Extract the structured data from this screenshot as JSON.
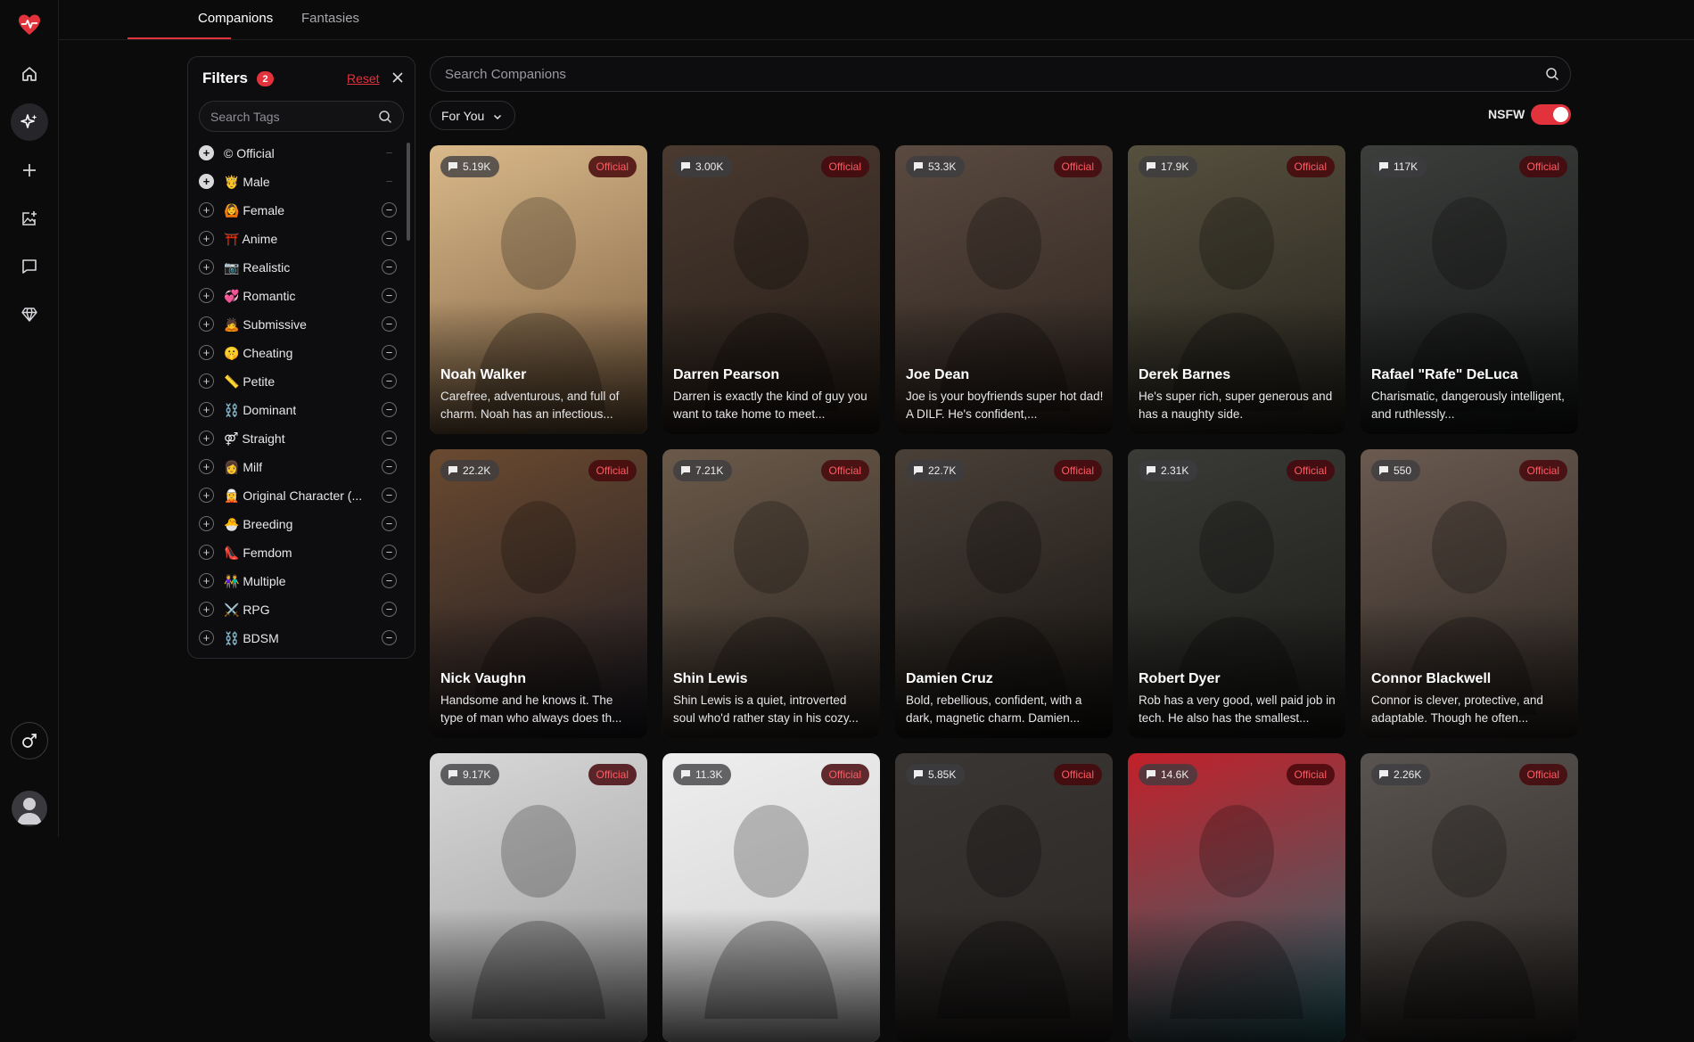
{
  "topbar": {
    "tabs": [
      {
        "label": "Companions",
        "active": true
      },
      {
        "label": "Fantasies",
        "active": false
      }
    ]
  },
  "rail": {
    "items": [
      "home-icon",
      "sparkles-icon",
      "plus-icon",
      "image-plus-icon",
      "chat-icon",
      "diamond-icon"
    ],
    "gender": "male-icon",
    "accent": "#e2323c"
  },
  "filters": {
    "title": "Filters",
    "count": "2",
    "reset": "Reset",
    "tag_search_placeholder": "Search Tags",
    "tags": [
      {
        "label": "© Official",
        "on": true
      },
      {
        "label": "🤴 Male",
        "on": true
      },
      {
        "label": "🙆 Female",
        "on": false
      },
      {
        "label": "⛩️ Anime",
        "on": false
      },
      {
        "label": "📷 Realistic",
        "on": false
      },
      {
        "label": "💞 Romantic",
        "on": false
      },
      {
        "label": "🙇 Submissive",
        "on": false
      },
      {
        "label": "🤫 Cheating",
        "on": false
      },
      {
        "label": "📏 Petite",
        "on": false
      },
      {
        "label": "⛓️ Dominant",
        "on": false
      },
      {
        "label": "⚤ Straight",
        "on": false
      },
      {
        "label": "👩 Milf",
        "on": false
      },
      {
        "label": "🧝 Original Character (...",
        "on": false
      },
      {
        "label": "🐣 Breeding",
        "on": false
      },
      {
        "label": "👠 Femdom",
        "on": false
      },
      {
        "label": "👫 Multiple",
        "on": false
      },
      {
        "label": "⚔️ RPG",
        "on": false
      },
      {
        "label": "⛓️ BDSM",
        "on": false
      }
    ]
  },
  "search": {
    "placeholder": "Search Companions"
  },
  "toolbar": {
    "sort_label": "For You",
    "nsfw_label": "NSFW",
    "nsfw_on": true
  },
  "cards": [
    {
      "name": "Noah Walker",
      "chats": "5.19K",
      "badge": "Official",
      "desc": "Carefree, adventurous, and full of charm. Noah has an infectious...",
      "bg": [
        "#d9b98a",
        "#7a5c3e"
      ]
    },
    {
      "name": "Darren Pearson",
      "chats": "3.00K",
      "badge": "Official",
      "desc": "Darren is exactly the kind of guy you want to take home to meet...",
      "bg": [
        "#4a3a30",
        "#241c16"
      ]
    },
    {
      "name": "Joe Dean",
      "chats": "53.3K",
      "badge": "Official",
      "desc": "Joe is your boyfriends super hot dad! A DILF. He's confident,...",
      "bg": [
        "#5a4a40",
        "#2a211c"
      ]
    },
    {
      "name": "Derek Barnes",
      "chats": "17.9K",
      "badge": "Official",
      "desc": "He's super rich, super generous and has a naughty side.",
      "bg": [
        "#56503e",
        "#24221c"
      ]
    },
    {
      "name": "Rafael \"Rafe\" DeLuca",
      "chats": "117K",
      "badge": "Official",
      "desc": "Charismatic, dangerously intelligent, and ruthlessly...",
      "bg": [
        "#3c3e3c",
        "#141616"
      ]
    },
    {
      "name": "Nick Vaughn",
      "chats": "22.2K",
      "badge": "Official",
      "desc": "Handsome and he knows it. The type of man who always does th...",
      "bg": [
        "#6a4a30",
        "#1c1a22"
      ]
    },
    {
      "name": "Shin Lewis",
      "chats": "7.21K",
      "badge": "Official",
      "desc": "Shin Lewis is a quiet, introverted soul who'd rather stay in his cozy...",
      "bg": [
        "#6b5a4a",
        "#2a2420"
      ]
    },
    {
      "name": "Damien Cruz",
      "chats": "22.7K",
      "badge": "Official",
      "desc": "Bold, rebellious, confident, with a dark, magnetic charm. Damien...",
      "bg": [
        "#4a4038",
        "#141210"
      ]
    },
    {
      "name": "Robert Dyer",
      "chats": "2.31K",
      "badge": "Official",
      "desc": "Rob has a very good, well paid job in tech. He also has the smallest...",
      "bg": [
        "#3a3a36",
        "#1a1a18"
      ]
    },
    {
      "name": "Connor Blackwell",
      "chats": "550",
      "badge": "Official",
      "desc": "Connor is clever, protective, and adaptable. Though he often...",
      "bg": [
        "#6a5a50",
        "#2a2420"
      ]
    },
    {
      "name": "",
      "chats": "9.17K",
      "badge": "Official",
      "desc": "",
      "bg": [
        "#d8d8d8",
        "#9a9a9a"
      ]
    },
    {
      "name": "",
      "chats": "11.3K",
      "badge": "Official",
      "desc": "",
      "bg": [
        "#eeeeee",
        "#cfcfcf"
      ]
    },
    {
      "name": "",
      "chats": "5.85K",
      "badge": "Official",
      "desc": "",
      "bg": [
        "#3a3634",
        "#2a2624"
      ]
    },
    {
      "name": "",
      "chats": "14.6K",
      "badge": "Official",
      "desc": "",
      "bg": [
        "#c2202a",
        "#2a6a70"
      ]
    },
    {
      "name": "",
      "chats": "2.26K",
      "badge": "Official",
      "desc": "",
      "bg": [
        "#5a5450",
        "#2a2624"
      ]
    }
  ]
}
